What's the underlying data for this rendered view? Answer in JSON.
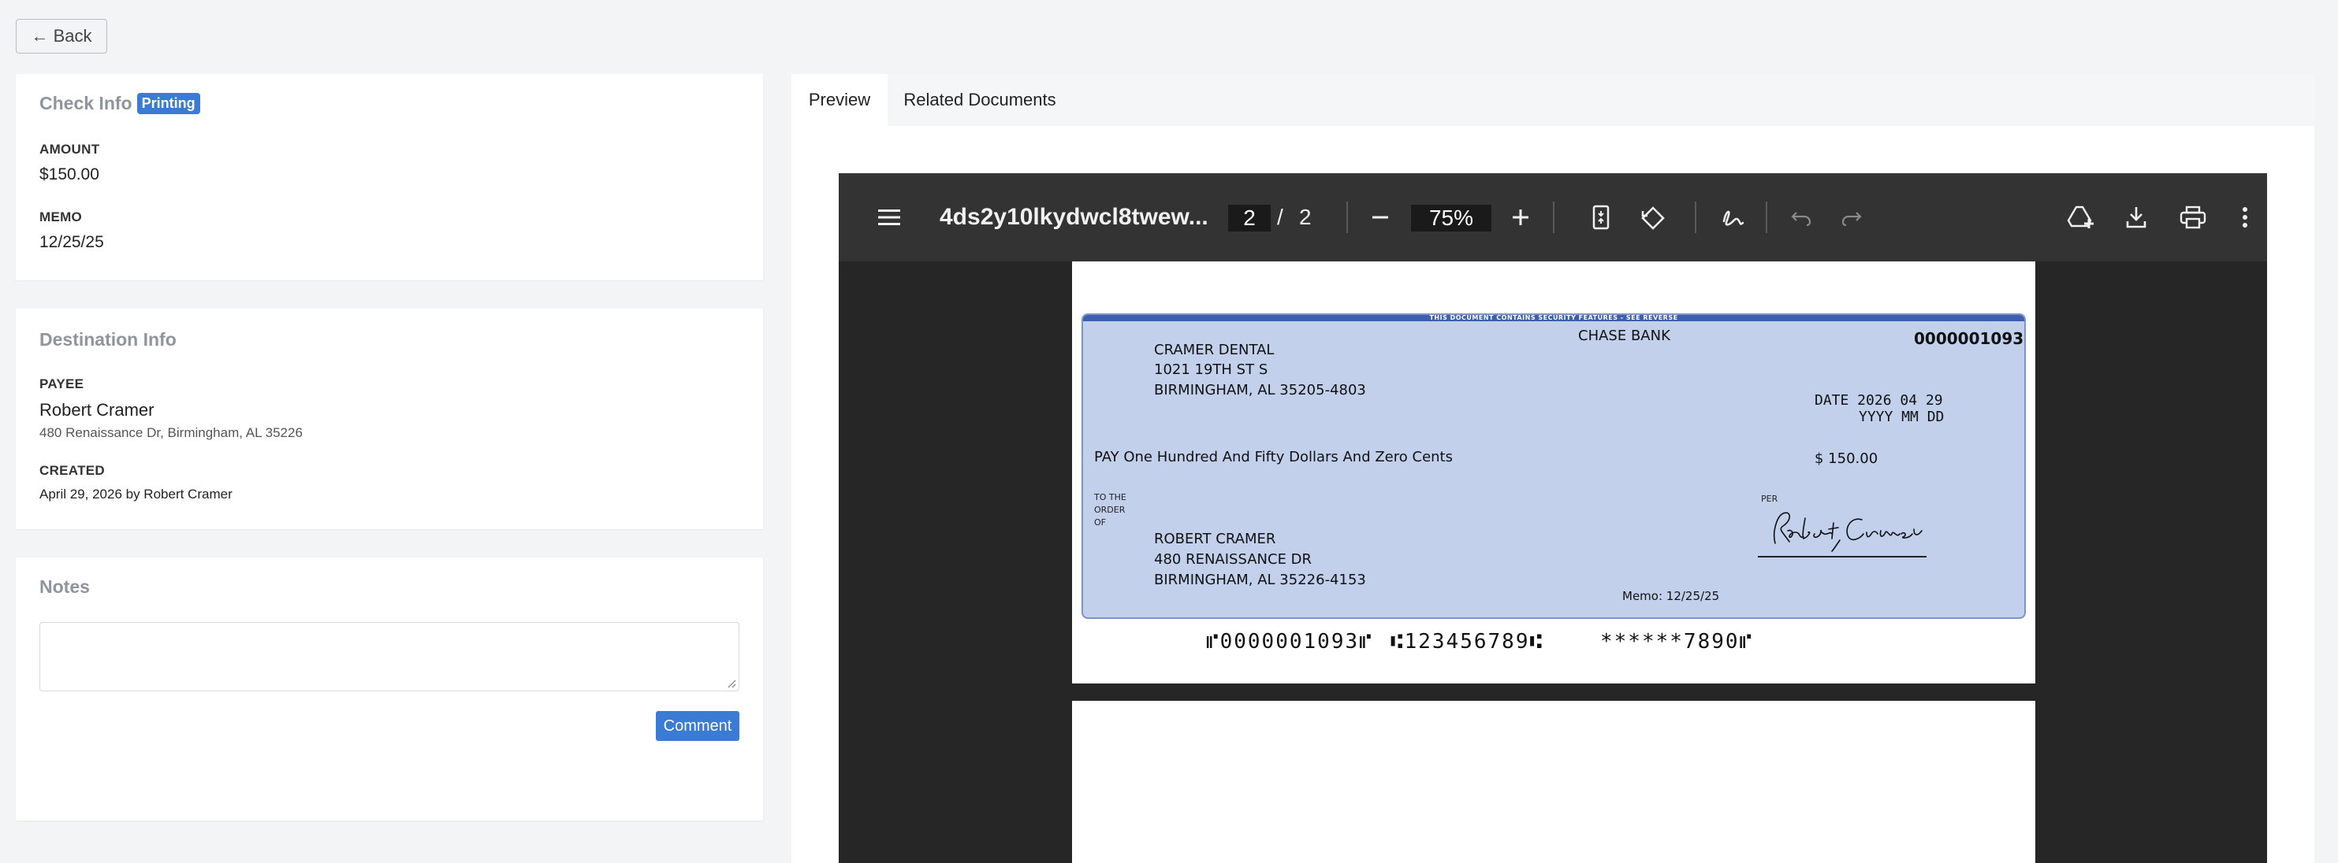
{
  "nav": {
    "back_label": "← Back"
  },
  "check_info": {
    "title": "Check Info",
    "status_badge": "Printing",
    "amount_label": "AMOUNT",
    "amount_value": "$150.00",
    "memo_label": "MEMO",
    "memo_value": "12/25/25"
  },
  "destination_info": {
    "title": "Destination Info",
    "payee_label": "PAYEE",
    "payee_name": "Robert Cramer",
    "payee_address": "480 Renaissance Dr, Birmingham, AL 35226",
    "created_label": "CREATED",
    "created_value": "April 29, 2026 by Robert Cramer"
  },
  "notes": {
    "title": "Notes",
    "input_value": "",
    "comment_button": "Comment"
  },
  "tabs": [
    {
      "label": "Preview",
      "active": true
    },
    {
      "label": "Related Documents",
      "active": false
    }
  ],
  "pdf_viewer": {
    "file_title": "4ds2y10lkydwcl8twew...",
    "current_page": "2",
    "page_separator": "/",
    "total_pages": "2",
    "zoom": "75%",
    "icons": [
      "menu-icon",
      "zoom-out-icon",
      "zoom-in-icon",
      "fit-page-icon",
      "rotate-icon",
      "draw-icon",
      "undo-icon",
      "redo-icon",
      "save-to-drive-icon",
      "download-icon",
      "print-icon",
      "more-options-icon"
    ]
  },
  "check_document": {
    "security_text": "THIS DOCUMENT CONTAINS SECURITY FEATURES - SEE REVERSE",
    "bank_name": "CHASE BANK",
    "check_number": "0000001093",
    "drawer_name": "CRAMER DENTAL",
    "drawer_address_1": "1021 19TH ST S",
    "drawer_address_2": "BIRMINGHAM, AL 35205-4803",
    "date_line": "DATE 2026 04 29",
    "date_format": "YYYY MM DD",
    "pay_line": "PAY One Hundred And Fifty Dollars And Zero Cents",
    "amount": "$ 150.00",
    "to_the_order_of": "TO THE\nORDER\nOF",
    "payee_name": "ROBERT CRAMER",
    "payee_address_1": "480 RENAISSANCE DR",
    "payee_address_2": "BIRMINGHAM, AL 35226-4153",
    "per_label": "PER",
    "signature": "Robert Cramer",
    "memo": "Memo: 12/25/25",
    "micr_check": "⑈0000001093⑈",
    "micr_routing": "⑆123456789⑆",
    "micr_account": "******7890⑈"
  },
  "colors": {
    "accent": "#3a7bd5",
    "check_background": "#c2d0ec",
    "viewer_toolbar": "#333333",
    "viewer_background": "#262626"
  }
}
